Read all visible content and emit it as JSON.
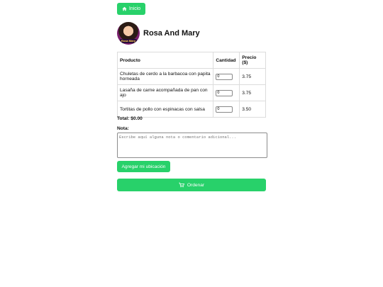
{
  "nav": {
    "home_label": "Inicio",
    "home_icon": "home-icon"
  },
  "store": {
    "name": "Rosa And Mary",
    "logo_text": "Rosa Mary"
  },
  "table": {
    "headers": {
      "product": "Producto",
      "quantity": "Cantidad",
      "price": "Precio ($)"
    },
    "rows": [
      {
        "product": "Chuletas de cerdo a la barbacoa con papita horneada",
        "quantity": "0",
        "price": "3.75"
      },
      {
        "product": "Lasaña de carne acompañada de pan con ajo",
        "quantity": "0",
        "price": "3.75"
      },
      {
        "product": "Tortitas de pollo con espinacas con salsa",
        "quantity": "0",
        "price": "3.50"
      }
    ]
  },
  "total": {
    "label": "Total: $0.00"
  },
  "note": {
    "label": "Nota:",
    "placeholder": "Escribe aquí alguna nota o comentario adicional..."
  },
  "location_button": {
    "label": "Agregar mi ubicación"
  },
  "order_button": {
    "label": "Ordenar",
    "icon": "cart-icon"
  },
  "colors": {
    "accent": "#28d16a"
  }
}
